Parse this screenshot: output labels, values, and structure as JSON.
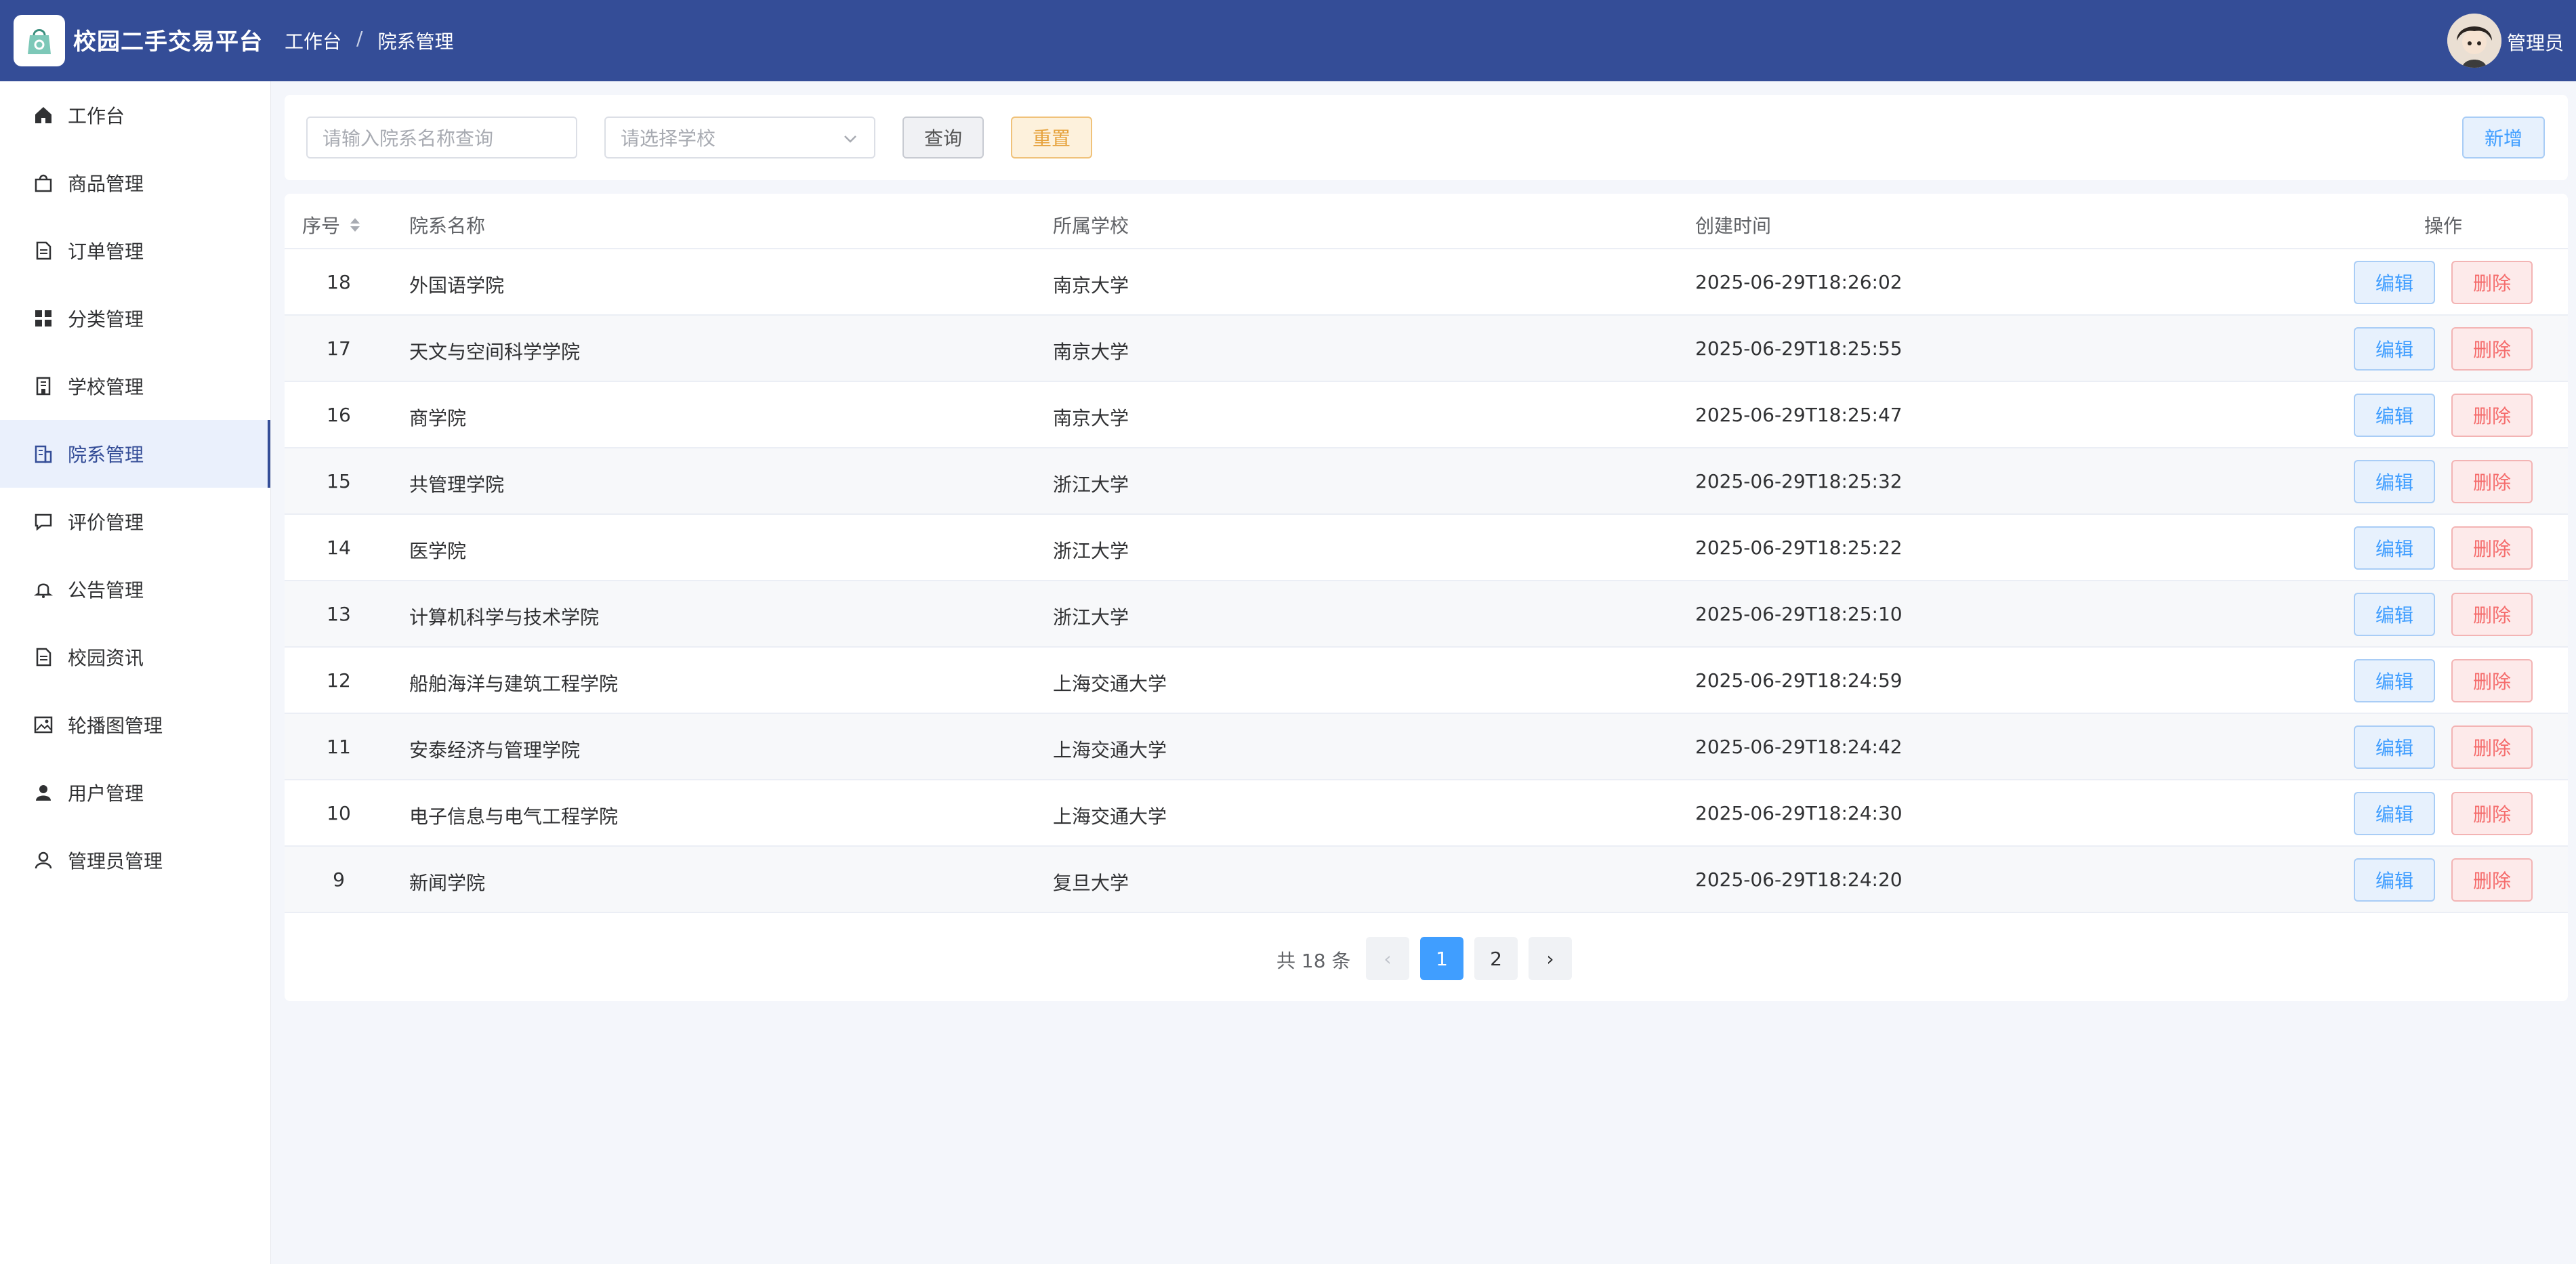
{
  "header": {
    "app_title": "校园二手交易平台",
    "breadcrumb": [
      "工作台",
      "院系管理"
    ],
    "breadcrumb_sep": "/",
    "user_name": "管理员",
    "bg_color": "#344d97"
  },
  "sidebar": {
    "items": [
      {
        "label": "工作台",
        "icon": "home-icon"
      },
      {
        "label": "商品管理",
        "icon": "bag-icon"
      },
      {
        "label": "订单管理",
        "icon": "document-icon"
      },
      {
        "label": "分类管理",
        "icon": "grid-icon"
      },
      {
        "label": "学校管理",
        "icon": "building-icon"
      },
      {
        "label": "院系管理",
        "icon": "office-building-icon",
        "active": true
      },
      {
        "label": "评价管理",
        "icon": "chat-icon"
      },
      {
        "label": "公告管理",
        "icon": "bell-icon"
      },
      {
        "label": "校园资讯",
        "icon": "document-icon"
      },
      {
        "label": "轮播图管理",
        "icon": "picture-icon"
      },
      {
        "label": "用户管理",
        "icon": "user-filled-icon"
      },
      {
        "label": "管理员管理",
        "icon": "user-icon"
      }
    ]
  },
  "search": {
    "name_placeholder": "请输入院系名称查询",
    "school_placeholder": "请选择学校",
    "query_label": "查询",
    "reset_label": "重置",
    "add_label": "新增"
  },
  "table": {
    "columns": [
      "序号",
      "院系名称",
      "所属学校",
      "创建时间",
      "操作"
    ],
    "edit_label": "编辑",
    "delete_label": "删除",
    "rows": [
      {
        "id": "18",
        "name": "外国语学院",
        "school": "南京大学",
        "created": "2025-06-29T18:26:02"
      },
      {
        "id": "17",
        "name": "天文与空间科学学院",
        "school": "南京大学",
        "created": "2025-06-29T18:25:55"
      },
      {
        "id": "16",
        "name": "商学院",
        "school": "南京大学",
        "created": "2025-06-29T18:25:47"
      },
      {
        "id": "15",
        "name": "共管理学院",
        "school": "浙江大学",
        "created": "2025-06-29T18:25:32"
      },
      {
        "id": "14",
        "name": "医学院",
        "school": "浙江大学",
        "created": "2025-06-29T18:25:22"
      },
      {
        "id": "13",
        "name": "计算机科学与技术学院",
        "school": "浙江大学",
        "created": "2025-06-29T18:25:10"
      },
      {
        "id": "12",
        "name": "船舶海洋与建筑工程学院",
        "school": "上海交通大学",
        "created": "2025-06-29T18:24:59"
      },
      {
        "id": "11",
        "name": "安泰经济与管理学院",
        "school": "上海交通大学",
        "created": "2025-06-29T18:24:42"
      },
      {
        "id": "10",
        "name": "电子信息与电气工程学院",
        "school": "上海交通大学",
        "created": "2025-06-29T18:24:30"
      },
      {
        "id": "9",
        "name": "新闻学院",
        "school": "复旦大学",
        "created": "2025-06-29T18:24:20"
      }
    ]
  },
  "pagination": {
    "total_text": "共 18 条",
    "pages": [
      "1",
      "2"
    ],
    "current": "1",
    "prev_icon": "‹",
    "next_icon": "›"
  }
}
